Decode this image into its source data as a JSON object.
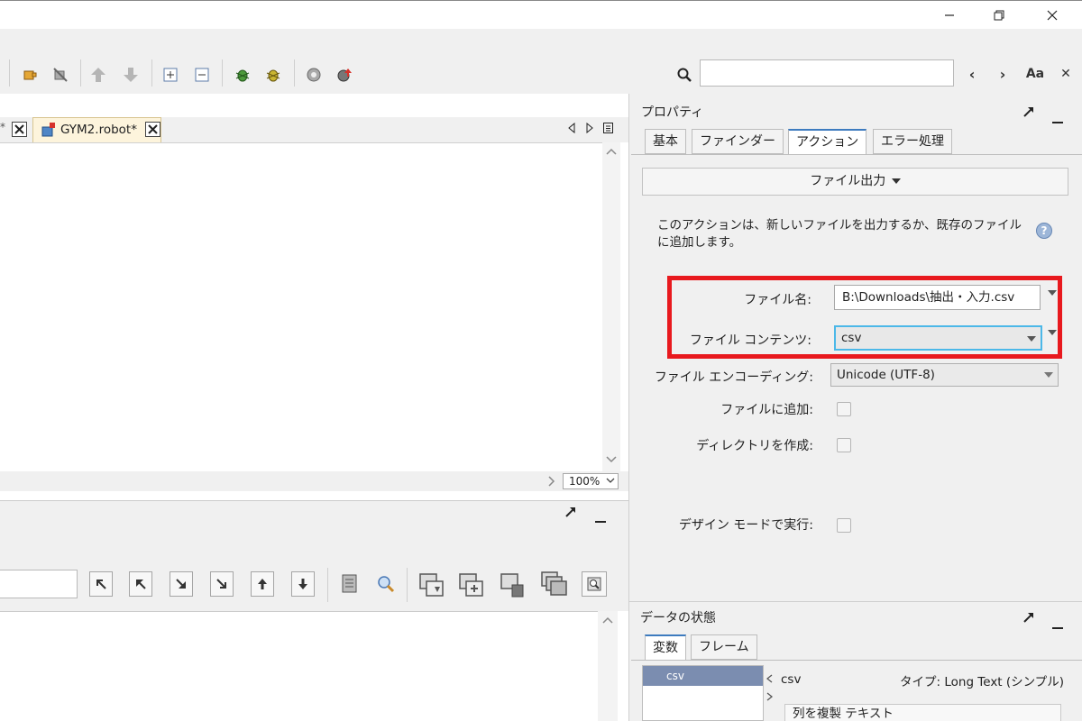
{
  "window": {
    "minimize_icon": "minimize-icon",
    "maximize_icon": "restore-icon",
    "close_icon": "close-icon"
  },
  "toolbar": {
    "nav_prev": "‹",
    "nav_next": "›",
    "match_case": "Aa",
    "close_search": "✕"
  },
  "editor": {
    "tab_label": "GYM2.robot*",
    "zoom": "100%"
  },
  "properties": {
    "title": "プロパティ",
    "tabs": [
      "基本",
      "ファインダー",
      "アクション",
      "エラー処理"
    ],
    "active_tab": "アクション",
    "action_label": "ファイル出力",
    "description": "このアクションは、新しいファイルを出力するか、既存のファイルに追加します。",
    "fields": {
      "filename_label": "ファイル名:",
      "filename_value": "B:\\Downloads\\抽出・入力.csv",
      "content_label": "ファイル コンテンツ:",
      "content_value": "csv",
      "encoding_label": "ファイル エンコーディング:",
      "encoding_value": "Unicode (UTF-8)",
      "append_label": "ファイルに追加:",
      "mkdir_label": "ディレクトリを作成:",
      "design_mode_label": "デザイン モードで実行:"
    }
  },
  "data_state": {
    "title": "データの状態",
    "tabs": [
      "変数",
      "フレーム"
    ],
    "selected_var": "csv",
    "var_name": "csv",
    "var_type": "タイプ: Long Text (シンプル)",
    "detail_text": "列を複製 テキスト"
  },
  "colors": {
    "highlight": "#e8191e",
    "focus": "#4cb8e8",
    "selected": "#7b8db0"
  }
}
